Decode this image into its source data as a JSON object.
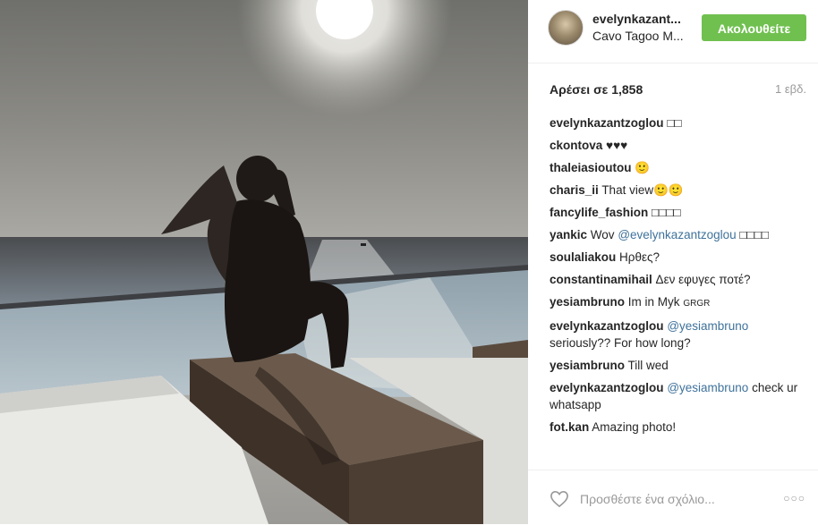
{
  "post": {
    "author": {
      "username": "evelynkazant...",
      "location": "Cavo Tagoo M..."
    },
    "follow_label": "Ακολουθείτε",
    "likes": "Αρέσει σε 1,858",
    "time_ago": "1 εβδ.",
    "comments": [
      {
        "user": "evelynkazantzoglou",
        "mention": "",
        "text": "□□"
      },
      {
        "user": "ckontova",
        "mention": "",
        "text": "♥♥♥"
      },
      {
        "user": "thaleiasioutou",
        "mention": "",
        "text": "🙂"
      },
      {
        "user": "charis_ii",
        "mention": "",
        "text": "That view🙂🙂"
      },
      {
        "user": "fancylife_fashion",
        "mention": "",
        "text": "□□□□"
      },
      {
        "user": "yankic",
        "mention": "@evelynkazantzoglou",
        "text": "Wov",
        "text_after": "□□□□"
      },
      {
        "user": "soulaliakou",
        "mention": "",
        "text": "Ηρθες?"
      },
      {
        "user": "constantinamihail",
        "mention": "",
        "text": "Δεν εφυγες ποτέ?"
      },
      {
        "user": "yesiambruno",
        "mention": "",
        "text": "Im in Myk",
        "text_after": "GRGR"
      },
      {
        "user": "evelynkazantzoglou",
        "mention": "@yesiambruno",
        "text": "",
        "text_after": "seriously?? For how long?"
      },
      {
        "user": "yesiambruno",
        "mention": "",
        "text": "Till wed"
      },
      {
        "user": "evelynkazantzoglou",
        "mention": "@yesiambruno",
        "text": "",
        "text_after": "check ur whatsapp"
      },
      {
        "user": "fot.kan",
        "mention": "",
        "text": "Amazing photo!"
      }
    ],
    "comment_placeholder": "Προσθέστε ένα σχόλιο...",
    "more_label": "○○○"
  },
  "icons": {
    "like": "heart-outline-icon",
    "more": "ellipsis-icon"
  },
  "colors": {
    "follow_button": "#70c050",
    "mention": "#3f729b",
    "muted": "#999999"
  }
}
